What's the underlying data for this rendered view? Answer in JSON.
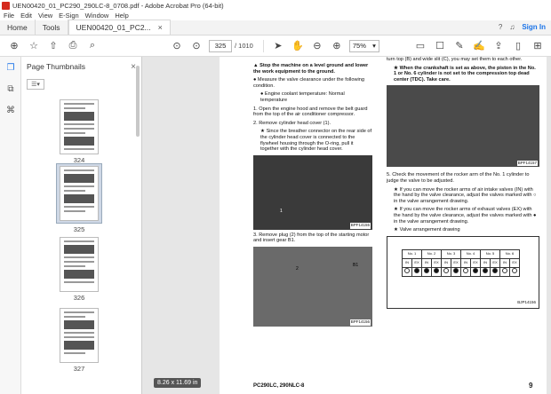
{
  "window": {
    "title": "UEN00420_01_PC290_290LC-8_0708.pdf - Adobe Acrobat Pro (64-bit)"
  },
  "menu": [
    "File",
    "Edit",
    "View",
    "E-Sign",
    "Window",
    "Help"
  ],
  "tabs": {
    "home": "Home",
    "tools": "Tools",
    "doc": "UEN00420_01_PC2..."
  },
  "account": {
    "signin": "Sign In"
  },
  "toolbar": {
    "page_current": "325",
    "page_total": "/ 1010",
    "zoom": "75%"
  },
  "panel": {
    "title": "Page Thumbnails"
  },
  "thumbnails": [
    {
      "label": "324"
    },
    {
      "label": "325"
    },
    {
      "label": "326"
    },
    {
      "label": "327"
    }
  ],
  "status": {
    "page_size": "8.26 x 11.69 in"
  },
  "doc": {
    "c1": [
      "▲ Stop the machine on a level ground and lower the work equipment to the ground.",
      "● Measure the valve clearance under the following condition.",
      "● Engine coolant temperature: Normal temperature",
      "1. Open the engine hood and remove the belt guard from the top of the air conditioner compressor.",
      "2. Remove cylinder head cover (1).",
      "★ Since the breather connector on the rear side of the cylinder head cover is connected to the flywheel housing through the O-ring, pull it together with the cylinder head cover.",
      "3. Remove plug (2) from the top of the starting motor and insert gear B1."
    ],
    "c2": [
      "turn top (B) and wide slit (C), you may set them to each other.",
      "★ When the crankshaft is set as above, the piston in the No. 1 or No. 6 cylinder is not set to the compression top dead center (TDC). Take care.",
      "5. Check the movement of the rocker arm of the No. 1 cylinder to judge the valve to be adjusted.",
      "★ If you can move the rocker arms of air intake valves (IN) with the hand by the valve clearance, adjust the valves marked with ○ in the valve arrangement drawing.",
      "★ If you can move the rocker arms of exhaust valves (EX) with the hand by the valve clearance, adjust the valves marked with ● in the valve arrangement drawing.",
      "★ Valve arrangement drawing"
    ],
    "photo1_cap": "BPF14155",
    "photo1_lbl": "1",
    "photo2_cap": "BPF14156",
    "photo2_lbl": "B1",
    "photo2_lbl2": "2",
    "photo3_cap": "BPF14157",
    "diagram_cap": "BJP14156",
    "footer": "PC290LC, 290NLC-8",
    "pagenum": "9"
  },
  "valves": {
    "cyl": [
      "No. 1",
      "No. 2",
      "No. 3",
      "No. 4",
      "No. 5",
      "No. 6"
    ],
    "io": [
      "IN",
      "EX",
      "IN",
      "EX",
      "IN",
      "EX",
      "IN",
      "EX",
      "IN",
      "EX",
      "IN",
      "EX"
    ]
  }
}
